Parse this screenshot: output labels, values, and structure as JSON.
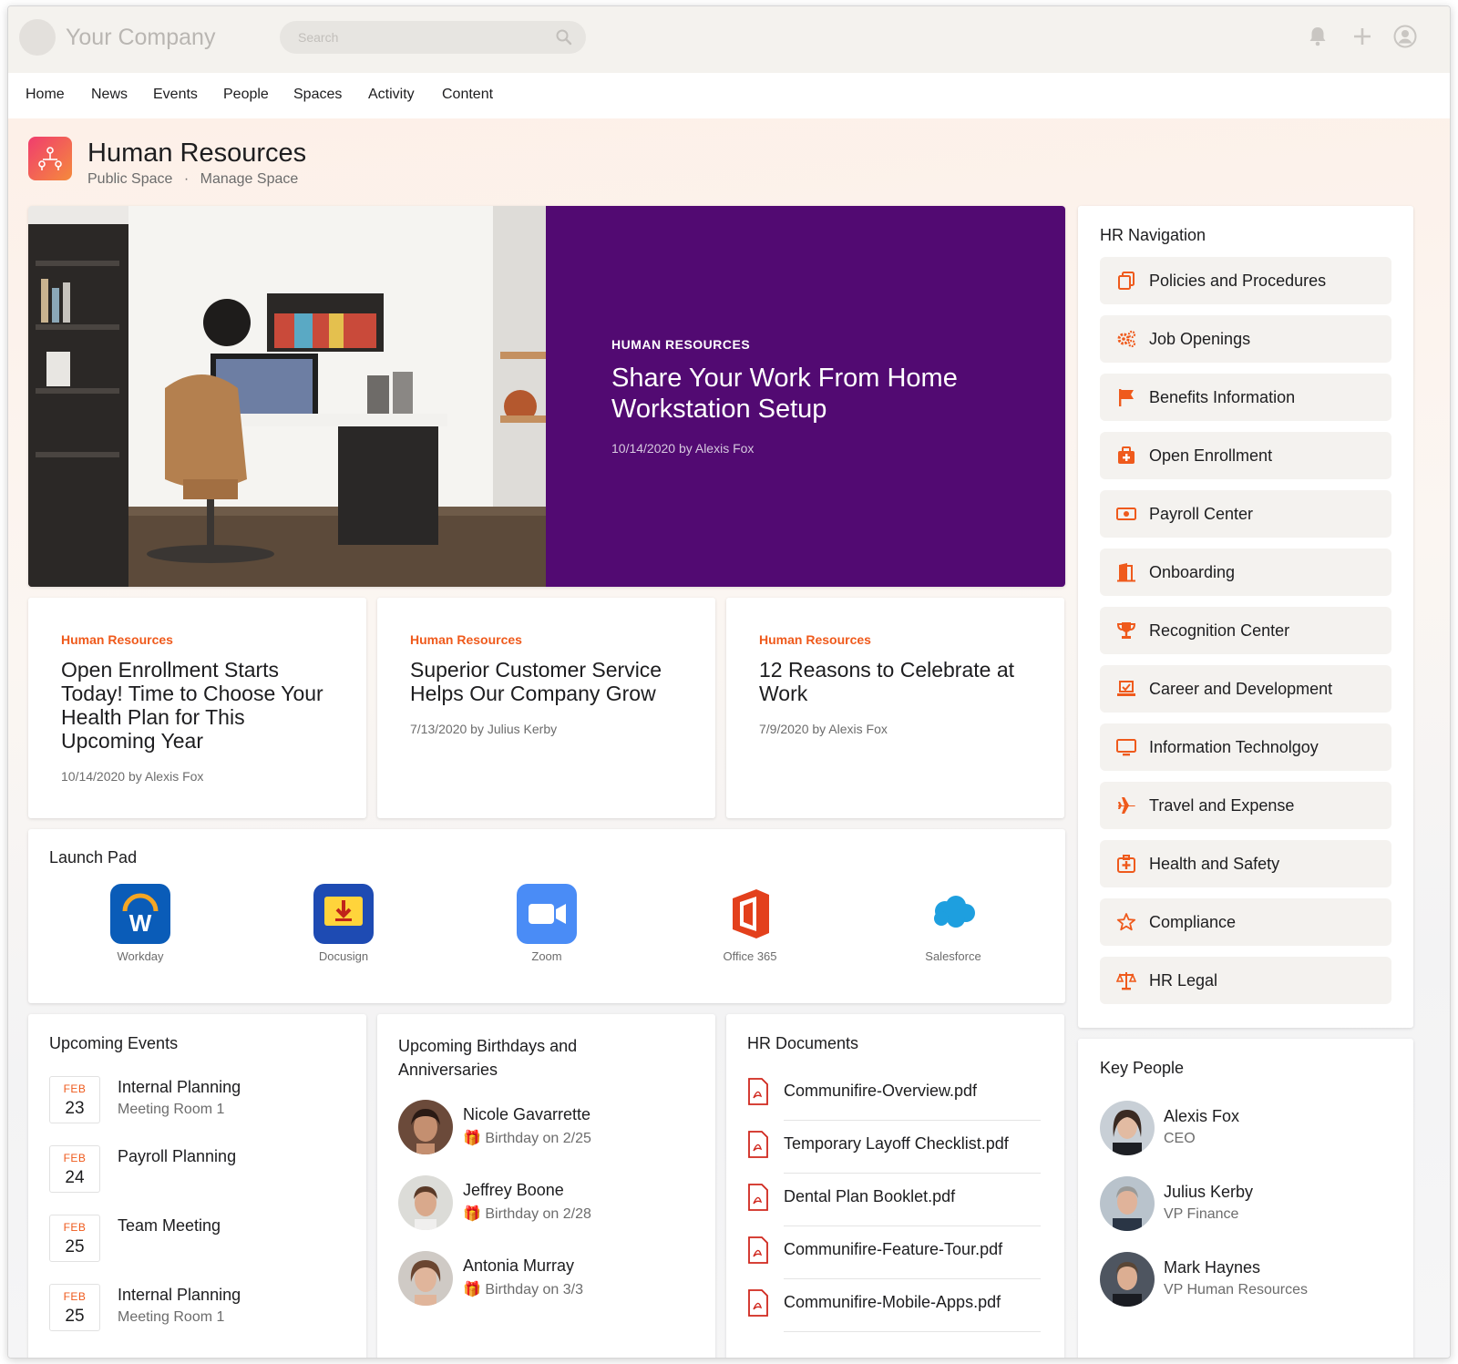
{
  "header": {
    "brand": "Your Company",
    "search_placeholder": "Search"
  },
  "nav": [
    "Home",
    "News",
    "Events",
    "People",
    "Spaces",
    "Activity",
    "Content"
  ],
  "space": {
    "title": "Human Resources",
    "visibility": "Public Space",
    "separator": "·",
    "manage": "Manage Space"
  },
  "hero": {
    "category": "HUMAN RESOURCES",
    "title": "Share Your Work From Home Workstation Setup",
    "meta": "10/14/2020 by Alexis Fox"
  },
  "news": [
    {
      "category": "Human Resources",
      "title": "Open Enrollment Starts Today! Time to Choose Your Health Plan for This Upcoming Year",
      "meta": "10/14/2020 by Alexis Fox"
    },
    {
      "category": "Human Resources",
      "title": "Superior Customer Service Helps Our Company Grow",
      "meta": "7/13/2020 by Julius Kerby"
    },
    {
      "category": "Human Resources",
      "title": "12 Reasons to Celebrate at Work",
      "meta": "7/9/2020 by Alexis Fox"
    }
  ],
  "launchpad": {
    "title": "Launch Pad",
    "apps": [
      {
        "label": "Workday",
        "icon": "workday-icon"
      },
      {
        "label": "Docusign",
        "icon": "docusign-icon"
      },
      {
        "label": "Zoom",
        "icon": "zoom-icon"
      },
      {
        "label": "Office 365",
        "icon": "office365-icon"
      },
      {
        "label": "Salesforce",
        "icon": "salesforce-icon"
      }
    ]
  },
  "events": {
    "title": "Upcoming Events",
    "items": [
      {
        "month": "FEB",
        "day": "23",
        "title": "Internal Planning",
        "location": "Meeting Room 1"
      },
      {
        "month": "FEB",
        "day": "24",
        "title": "Payroll Planning",
        "location": ""
      },
      {
        "month": "FEB",
        "day": "25",
        "title": "Team Meeting",
        "location": ""
      },
      {
        "month": "FEB",
        "day": "25",
        "title": "Internal Planning",
        "location": "Meeting Room 1"
      }
    ]
  },
  "birthdays": {
    "title": "Upcoming Birthdays and Anniversaries",
    "items": [
      {
        "name": "Nicole Gavarrette",
        "detail": "Birthday on 2/25"
      },
      {
        "name": "Jeffrey Boone",
        "detail": "Birthday on 2/28"
      },
      {
        "name": "Antonia Murray",
        "detail": "Birthday on 3/3"
      }
    ]
  },
  "documents": {
    "title": "HR Documents",
    "items": [
      "Communifire-Overview.pdf",
      "Temporary Layoff Checklist.pdf",
      "Dental Plan Booklet.pdf",
      "Communifire-Feature-Tour.pdf",
      "Communifire-Mobile-Apps.pdf"
    ]
  },
  "hr_nav": {
    "title": "HR Navigation",
    "items": [
      {
        "label": "Policies and Procedures",
        "icon": "copy-icon"
      },
      {
        "label": "Job Openings",
        "icon": "gears-icon"
      },
      {
        "label": "Benefits Information",
        "icon": "flag-icon"
      },
      {
        "label": "Open Enrollment",
        "icon": "medical-kit-icon"
      },
      {
        "label": "Payroll Center",
        "icon": "money-icon"
      },
      {
        "label": "Onboarding",
        "icon": "door-icon"
      },
      {
        "label": "Recognition Center",
        "icon": "trophy-icon"
      },
      {
        "label": "Career and Development",
        "icon": "laptop-check-icon"
      },
      {
        "label": "Information Technolgoy",
        "icon": "desktop-icon"
      },
      {
        "label": "Travel and Expense",
        "icon": "plane-icon"
      },
      {
        "label": "Health and Safety",
        "icon": "first-aid-icon"
      },
      {
        "label": "Compliance",
        "icon": "star-icon"
      },
      {
        "label": "HR Legal",
        "icon": "scale-icon"
      }
    ]
  },
  "key_people": {
    "title": "Key People",
    "items": [
      {
        "name": "Alexis Fox",
        "role": "CEO"
      },
      {
        "name": "Julius Kerby",
        "role": "VP Finance"
      },
      {
        "name": "Mark Haynes",
        "role": "VP Human Resources"
      }
    ]
  },
  "colors": {
    "accent": "#ef5a1c",
    "hero_purple": "#520a72",
    "chip_bg": "#f4f2ef"
  }
}
